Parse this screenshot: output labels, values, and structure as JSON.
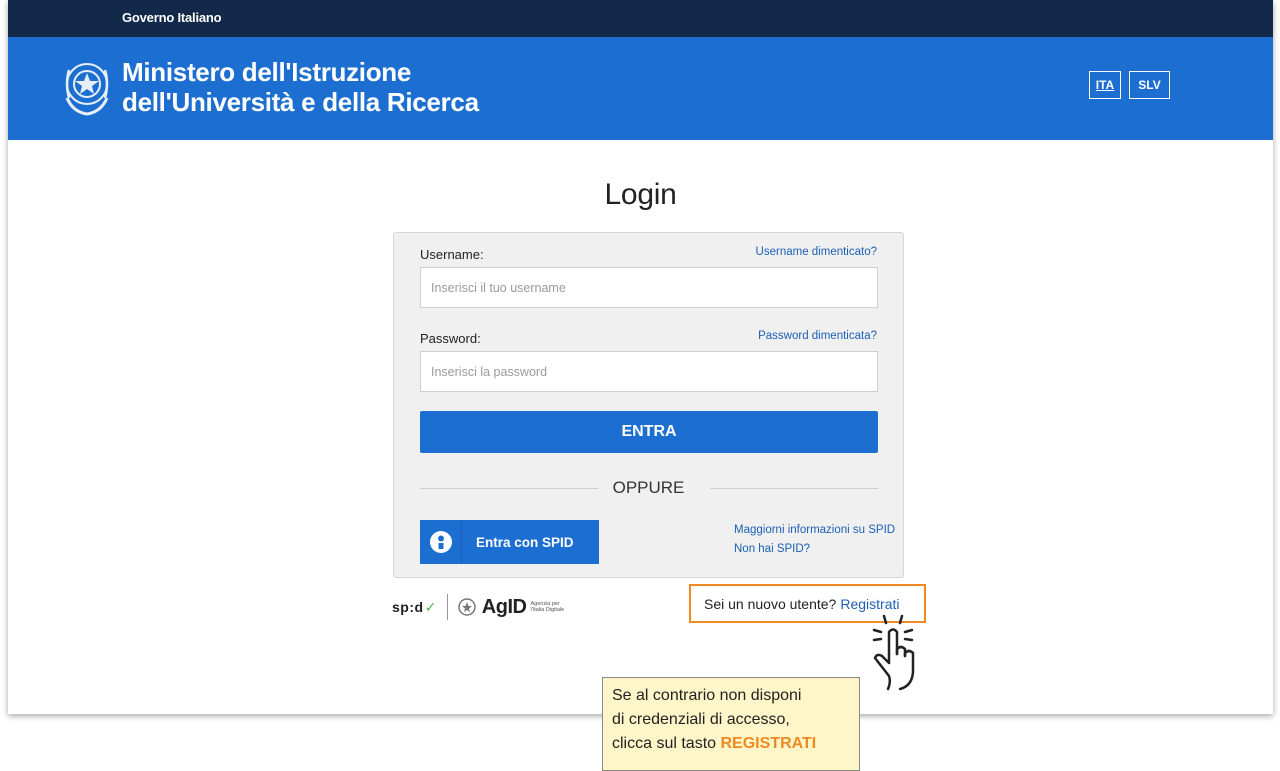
{
  "slim_header": {
    "text": "Governo Italiano"
  },
  "header": {
    "title_line1": "Ministero dell'Istruzione",
    "title_line2": "dell'Università e della Ricerca",
    "languages": [
      "ITA",
      "SLV"
    ],
    "active_language": "ITA"
  },
  "login": {
    "title": "Login",
    "username_label": "Username:",
    "username_forgot": "Username dimenticato?",
    "username_placeholder": "Inserisci il tuo username",
    "username_value": "",
    "password_label": "Password:",
    "password_forgot": "Password dimenticata?",
    "password_placeholder": "Inserisci la password",
    "password_value": "",
    "submit_label": "ENTRA",
    "separator_text": "OPPURE",
    "spid_button_label": "Entra con SPID",
    "spid_info_link": "Maggiorni informazioni su SPID",
    "no_spid_link": "Non hai SPID?"
  },
  "footer_logos": {
    "spid_text": "sp:d",
    "spid_check": "✓",
    "agid_text": "AgID",
    "agid_sub": "Agenzia per l'Italia Digitale"
  },
  "register": {
    "prompt": "Sei un nuovo utente?",
    "link": "Registrati"
  },
  "callout": {
    "line1": "Se al contrario non disponi",
    "line2": "di credenziali di accesso,",
    "line3_prefix": "clicca sul tasto",
    "line3_strong": "REGISTRATI"
  },
  "colors": {
    "slim_header_bg": "#13294a",
    "header_bg": "#1c6fd1",
    "primary_button": "#1c6fd1",
    "link": "#1c5fb5",
    "highlight_border": "#ef8a22",
    "callout_bg": "#fef6c8"
  },
  "icons": {
    "emblem": "italian-republic-emblem-icon",
    "spid": "spid-user-icon",
    "hand": "hand-pointer-icon",
    "agid": "agid-emblem-icon"
  }
}
